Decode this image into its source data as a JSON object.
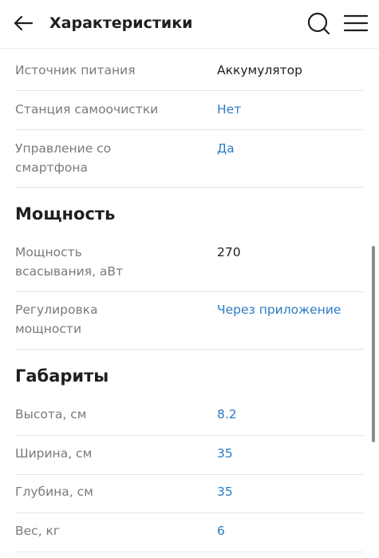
{
  "header": {
    "title": "Характеристики",
    "back_icon": "arrow-left-icon",
    "search_icon": "search-icon",
    "menu_icon": "menu-icon"
  },
  "rows_top": [
    {
      "label": "Источник питания",
      "value": "Аккумулятор"
    },
    {
      "label": "Станция самоочистки",
      "value": "Нет"
    },
    {
      "label": "Управление со смартфона",
      "value": "Да"
    }
  ],
  "sections": {
    "power": {
      "title": "Мощность",
      "rows": [
        {
          "label": "Мощность всасывания, аВт",
          "value": "270"
        },
        {
          "label": "Регулировка мощности",
          "value": "Через приложение"
        }
      ]
    },
    "dimensions": {
      "title": "Габариты",
      "rows": [
        {
          "label": "Высота, см",
          "value": "8.2"
        },
        {
          "label": "Ширина, см",
          "value": "35"
        },
        {
          "label": "Глубина, см",
          "value": "35"
        },
        {
          "label": "Вес, кг",
          "value": "6"
        }
      ]
    }
  },
  "colors": {
    "link": "#2b7bc4",
    "label": "#7a7a7a",
    "text": "#1f1f1f",
    "divider": "#e6e6e6"
  }
}
